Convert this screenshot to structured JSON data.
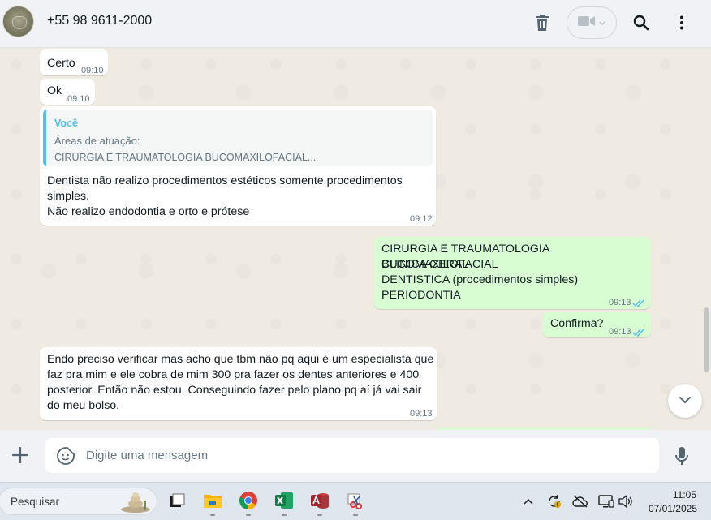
{
  "header": {
    "contact_name": "+55 98 9611-2000",
    "icons": [
      "trash-icon",
      "video-call-icon",
      "search-icon",
      "menu-icon"
    ]
  },
  "messages": [
    {
      "direction": "in",
      "text": "Certo",
      "time": "09:10"
    },
    {
      "direction": "in",
      "text": "Ok",
      "time": "09:10"
    },
    {
      "direction": "in",
      "quote": {
        "author": "Você",
        "line1": "Áreas de atuação:",
        "line2": "CIRURGIA E TRAUMATOLOGIA BUCOMAXILOFACIAL..."
      },
      "lines": [
        "Dentista não realizo procedimentos estéticos somente procedimentos",
        "simples.",
        "Não realizo endodontia e orto e prótese"
      ],
      "time": "09:12"
    },
    {
      "direction": "out",
      "lines": [
        "CIRURGIA E TRAUMATOLOGIA BUCOMAXILOFACIAL",
        "CLINICA GERAL",
        "DENTISTICA (procedimentos simples)",
        "PERIODONTIA"
      ],
      "time": "09:13",
      "status": "read"
    },
    {
      "direction": "out",
      "text": "Confirma?",
      "time": "09:13",
      "status": "read"
    },
    {
      "direction": "in",
      "lines": [
        "Endo preciso verificar mas acho que tbm não pq aqui é um especialista que",
        "faz pra mim e ele cobra de mim 300 pra fazer os dentes anteriores e 400",
        "posterior. Então não estou. Conseguindo fazer pelo plano pq aí já vai sair",
        "do meu bolso."
      ],
      "time": "09:13"
    }
  ],
  "composer": {
    "placeholder": "Digite uma mensagem"
  },
  "taskbar": {
    "search_label": "Pesquisar",
    "apps": [
      "task-view-icon",
      "file-explorer-icon",
      "chrome-icon",
      "excel-icon",
      "access-icon",
      "snipping-tool-icon"
    ],
    "tray_icons": [
      "chevron-up-icon",
      "sync-icon",
      "cloud-offline-icon",
      "display-icon",
      "speaker-icon"
    ],
    "time": "11:05",
    "date": "07/01/2025"
  },
  "colors": {
    "incoming_bubble": "#ffffff",
    "outgoing_bubble": "#d9fdd3",
    "read_ticks": "#53bdeb",
    "chat_background": "#efeae2",
    "header_background": "#f0f2f5"
  }
}
